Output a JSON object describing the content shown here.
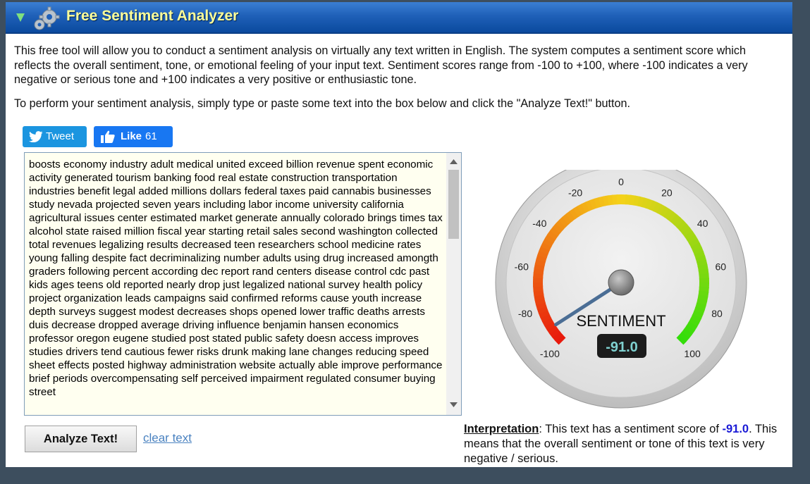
{
  "header": {
    "title": "Free Sentiment Analyzer",
    "collapse_icon": "triangle-down-icon",
    "logo_icon": "gears-icon"
  },
  "intro": {
    "description": "This free tool will allow you to conduct a sentiment analysis on virtually any text written in English. The system computes a sentiment score which reflects the overall sentiment, tone, or emotional feeling of your input text. Sentiment scores range from -100 to +100, where -100 indicates a very negative or serious tone and +100 indicates a very positive or enthusiastic tone.",
    "instructions": "To perform your sentiment analysis, simply type or paste some text into the box below and click the \"Analyze Text!\" button."
  },
  "social": {
    "tweet_label": "Tweet",
    "like_label": "Like",
    "like_count": "61"
  },
  "input": {
    "text": "boosts economy industry adult medical united exceed billion revenue spent economic activity generated tourism banking food real estate construction transportation industries benefit legal added millions dollars federal taxes paid cannabis businesses study nevada projected seven years including labor income university california agricultural issues center estimated market generate annually colorado brings times tax alcohol state raised million fiscal year starting retail sales second washington collected total revenues legalizing results decreased teen researchers school medicine rates young falling despite fact decriminalizing number adults using drug increased amongth graders following percent according dec report rand centers disease control cdc past kids ages teens old reported nearly drop just legalized national survey health policy project organization leads campaigns said confirmed reforms cause youth increase depth surveys suggest modest decreases shops opened lower traffic deaths arrests duis decrease dropped average driving influence benjamin hansen economics professor oregon eugene studied post stated public safety doesn access improves studies drivers tend cautious fewer risks drunk making lane changes reducing speed sheet effects posted highway administration website actually able improve performance brief periods overcompensating self perceived impairment regulated consumer buying street"
  },
  "actions": {
    "analyze_label": "Analyze Text!",
    "clear_label": "clear text"
  },
  "gauge": {
    "label": "SENTIMENT",
    "value": -91.0,
    "value_text": "-91.0",
    "min": -100,
    "max": 100,
    "tick_labels": [
      "-100",
      "-80",
      "-60",
      "-40",
      "-20",
      "0",
      "20",
      "40",
      "60",
      "80",
      "100"
    ],
    "colors": {
      "negative": "#e8190c",
      "neutral": "#f5d21a",
      "positive": "#33dd0a",
      "needle": "#4b6e95"
    }
  },
  "interpretation": {
    "label": "Interpretation",
    "text_before": ": This text has a sentiment score of ",
    "score": "-91.0",
    "text_after": ". This means that the overall sentiment or tone of this text is very negative / serious."
  }
}
